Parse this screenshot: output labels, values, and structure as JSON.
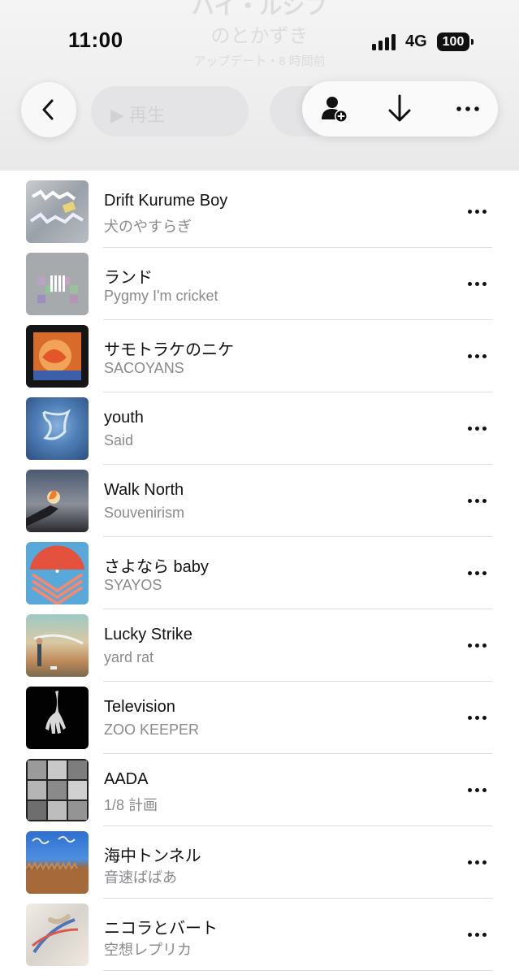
{
  "header": {
    "ghost_title": "ハイ・ルシフ",
    "ghost_owner": "のとかずき",
    "ghost_updated": "アップデート・8 時間前",
    "ghost_play_label": "▶ 再生"
  },
  "status": {
    "time": "11:00",
    "network": "4G",
    "battery": "100"
  },
  "toolbar": {
    "back_icon": "chevron-left-icon",
    "add_person_icon": "person-add-icon",
    "download_icon": "arrow-down-icon",
    "more_icon": "ellipsis-icon"
  },
  "tracks": [
    {
      "title": "Drift Kurume Boy",
      "artist": "犬のやすらぎ"
    },
    {
      "title": "ランド",
      "artist": "Pygmy I'm cricket"
    },
    {
      "title": "サモトラケのニケ",
      "artist": "SACOYANS"
    },
    {
      "title": "youth",
      "artist": "Said"
    },
    {
      "title": "Walk North",
      "artist": "Souvenirism"
    },
    {
      "title": "さよなら baby",
      "artist": "SYAYOS"
    },
    {
      "title": "Lucky Strike",
      "artist": "yard rat"
    },
    {
      "title": "Television",
      "artist": "ZOO KEEPER"
    },
    {
      "title": "AADA",
      "artist": "1/8 計画"
    },
    {
      "title": "海中トンネル",
      "artist": "音速ばばあ"
    },
    {
      "title": "ニコラとバート",
      "artist": "空想レプリカ"
    }
  ]
}
